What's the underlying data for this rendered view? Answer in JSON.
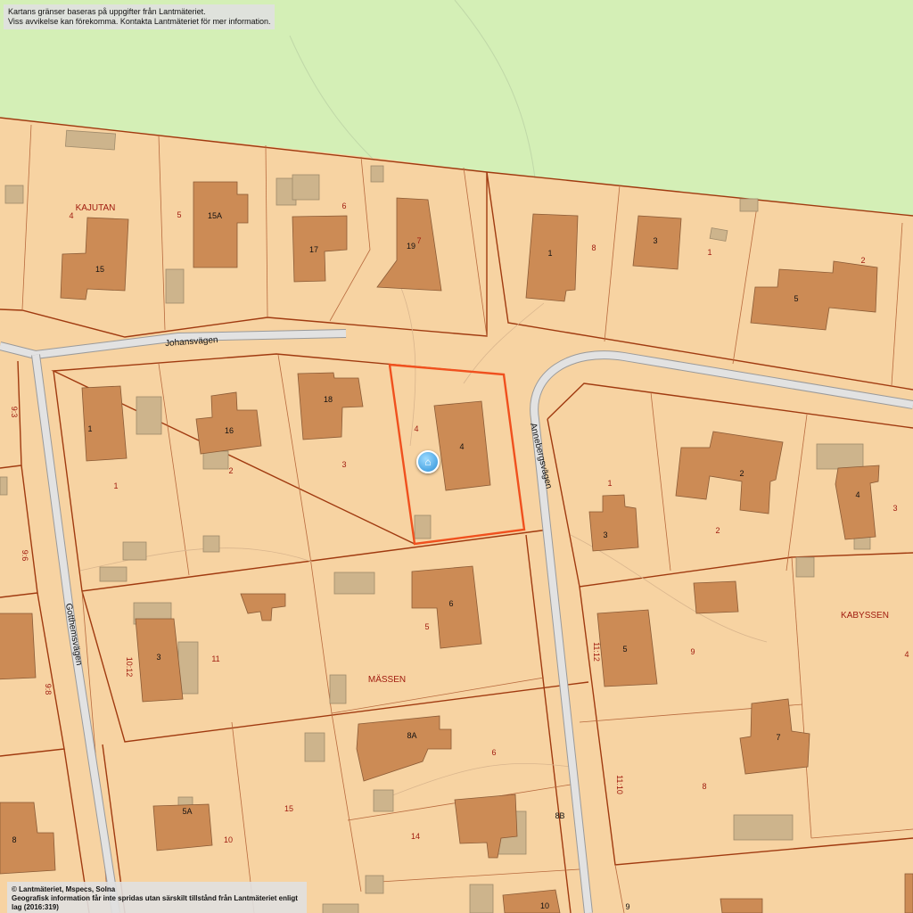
{
  "disclaimer": {
    "line1": "Kartans gränser baseras på uppgifter från Lantmäteriet.",
    "line2": "Viss avvikelse kan förekomma. Kontakta Lantmäteriet för mer information."
  },
  "copyright": {
    "line1": "© Lantmäteriet, Mspecs, Solna",
    "line2": "Geografisk information får inte spridas utan särskilt tillstånd från Lantmäteriet enligt lag (2016:319)"
  },
  "streets": {
    "johansvagen": "Johansvägen",
    "annebergsvagen": "Annebergsvägen",
    "gotthemsvagen": "Gotthemsvägen"
  },
  "areas": {
    "kajutan": "KAJUTAN",
    "massen": "MÄSSEN",
    "kabyssen": "KABYSSEN"
  },
  "parcel_numbers": {
    "p_4a": "4",
    "p_5a": "5",
    "p_6a": "6",
    "p_7a": "7",
    "p_8a": "8",
    "p_1a": "1",
    "p_2a": "2",
    "p_1b": "1",
    "p_2b": "2",
    "p_3b": "3",
    "p_4sel": "4",
    "p_93": "9:3",
    "p_96": "9:6",
    "p_98": "9:8",
    "p_1012": "10:12",
    "p_11a": "11",
    "p_5b": "5",
    "p_6b": "6",
    "p_14": "14",
    "p_15": "15",
    "p_10": "10",
    "p_1c": "1",
    "p_2c": "2",
    "p_3c": "3",
    "p_4c": "4",
    "p_1112": "11:12",
    "p_9a": "9",
    "p_8c": "8",
    "p_1110": "11:10",
    "p_9b": "9"
  },
  "building_numbers": {
    "b_15": "15",
    "b_15a": "15A",
    "b_17": "17",
    "b_19": "19",
    "b_1a": "1",
    "b_3a": "3",
    "b_5a": "5",
    "b_1b": "1",
    "b_16": "16",
    "b_18": "18",
    "b_4": "4",
    "b_3b": "3",
    "b_6": "6",
    "b_8a": "8A",
    "b_5aa": "5A",
    "b_8": "8",
    "b_8b": "8B",
    "b_10": "10",
    "b_2": "2",
    "b_3c": "3",
    "b_4c": "4",
    "b_5c": "5",
    "b_7": "7"
  },
  "colors": {
    "parcel": "#f7d3a2",
    "forest": "#d4efb6",
    "building": "#cc8b55",
    "outbuilding": "#cdb48c",
    "boundary": "#a03a10",
    "road": "#d8d8d8",
    "selected_boundary": "#f0501e"
  },
  "marker": {
    "icon": "home-icon"
  }
}
